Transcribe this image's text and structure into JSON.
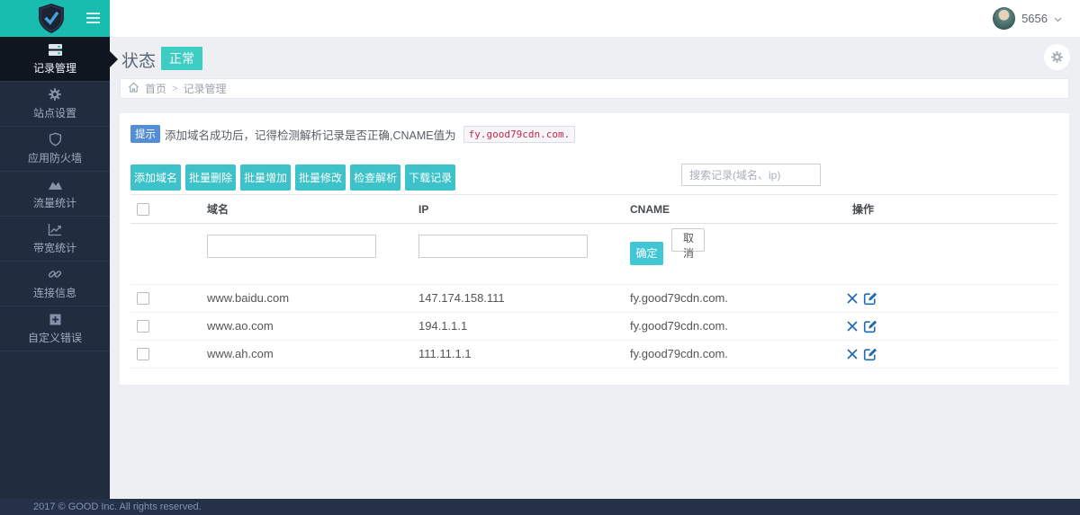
{
  "topbar": {
    "username": "5656"
  },
  "sidebar": {
    "items": [
      {
        "id": "records",
        "label": "记录管理",
        "icon": "records-icon",
        "active": true
      },
      {
        "id": "site-settings",
        "label": "站点设置",
        "icon": "gear-icon"
      },
      {
        "id": "app-firewall",
        "label": "应用防火墙",
        "icon": "shield-icon"
      },
      {
        "id": "traffic-stats",
        "label": "流量统计",
        "icon": "area-chart-icon"
      },
      {
        "id": "bandwidth-stats",
        "label": "带宽统计",
        "icon": "line-chart-icon"
      },
      {
        "id": "connection-info",
        "label": "连接信息",
        "icon": "link-icon"
      },
      {
        "id": "custom-error",
        "label": "自定义错误",
        "icon": "plus-square-icon"
      }
    ]
  },
  "page": {
    "title": "状态",
    "status": "正常"
  },
  "breadcrumb": {
    "home": "首页",
    "separator": ">",
    "current": "记录管理"
  },
  "alert": {
    "badge": "提示",
    "text": "添加域名成功后，记得检测解析记录是否正确,CNAME值为",
    "code": "fy.good79cdn.com."
  },
  "toolbar": {
    "buttons": [
      {
        "id": "add-domain",
        "label": "添加域名"
      },
      {
        "id": "batch-delete",
        "label": "批量删除"
      },
      {
        "id": "batch-add",
        "label": "批量增加"
      },
      {
        "id": "batch-edit",
        "label": "批量修改"
      },
      {
        "id": "check-resolve",
        "label": "检查解析"
      },
      {
        "id": "download-records",
        "label": "下载记录"
      }
    ],
    "search_placeholder": "搜索记录(域名、ip)"
  },
  "table": {
    "headers": [
      "域名",
      "IP",
      "CNAME",
      "操作"
    ],
    "filter": {
      "confirm": "确定",
      "cancel": "取消"
    },
    "rows": [
      {
        "domain": "www.baidu.com",
        "ip": "147.174.158.111",
        "cname": "fy.good79cdn.com."
      },
      {
        "domain": "www.ao.com",
        "ip": "194.1.1.1",
        "cname": "fy.good79cdn.com."
      },
      {
        "domain": "www.ah.com",
        "ip": "111.11.1.1",
        "cname": "fy.good79cdn.com."
      }
    ]
  },
  "footer": {
    "copyright": "2017 © GOOD Inc. All rights reserved."
  },
  "colors": {
    "brand_teal": "#18bdb0",
    "button_teal": "#3cc2c8",
    "status_badge_teal": "#3ecdc3",
    "confirm_cyan": "#41c6d6",
    "action_blue": "#1f6cb4",
    "alert_badge_blue": "#538dd3",
    "code_red": "#c7254e",
    "sidebar_navy": "#222c3f",
    "footer_navy": "#253049"
  }
}
